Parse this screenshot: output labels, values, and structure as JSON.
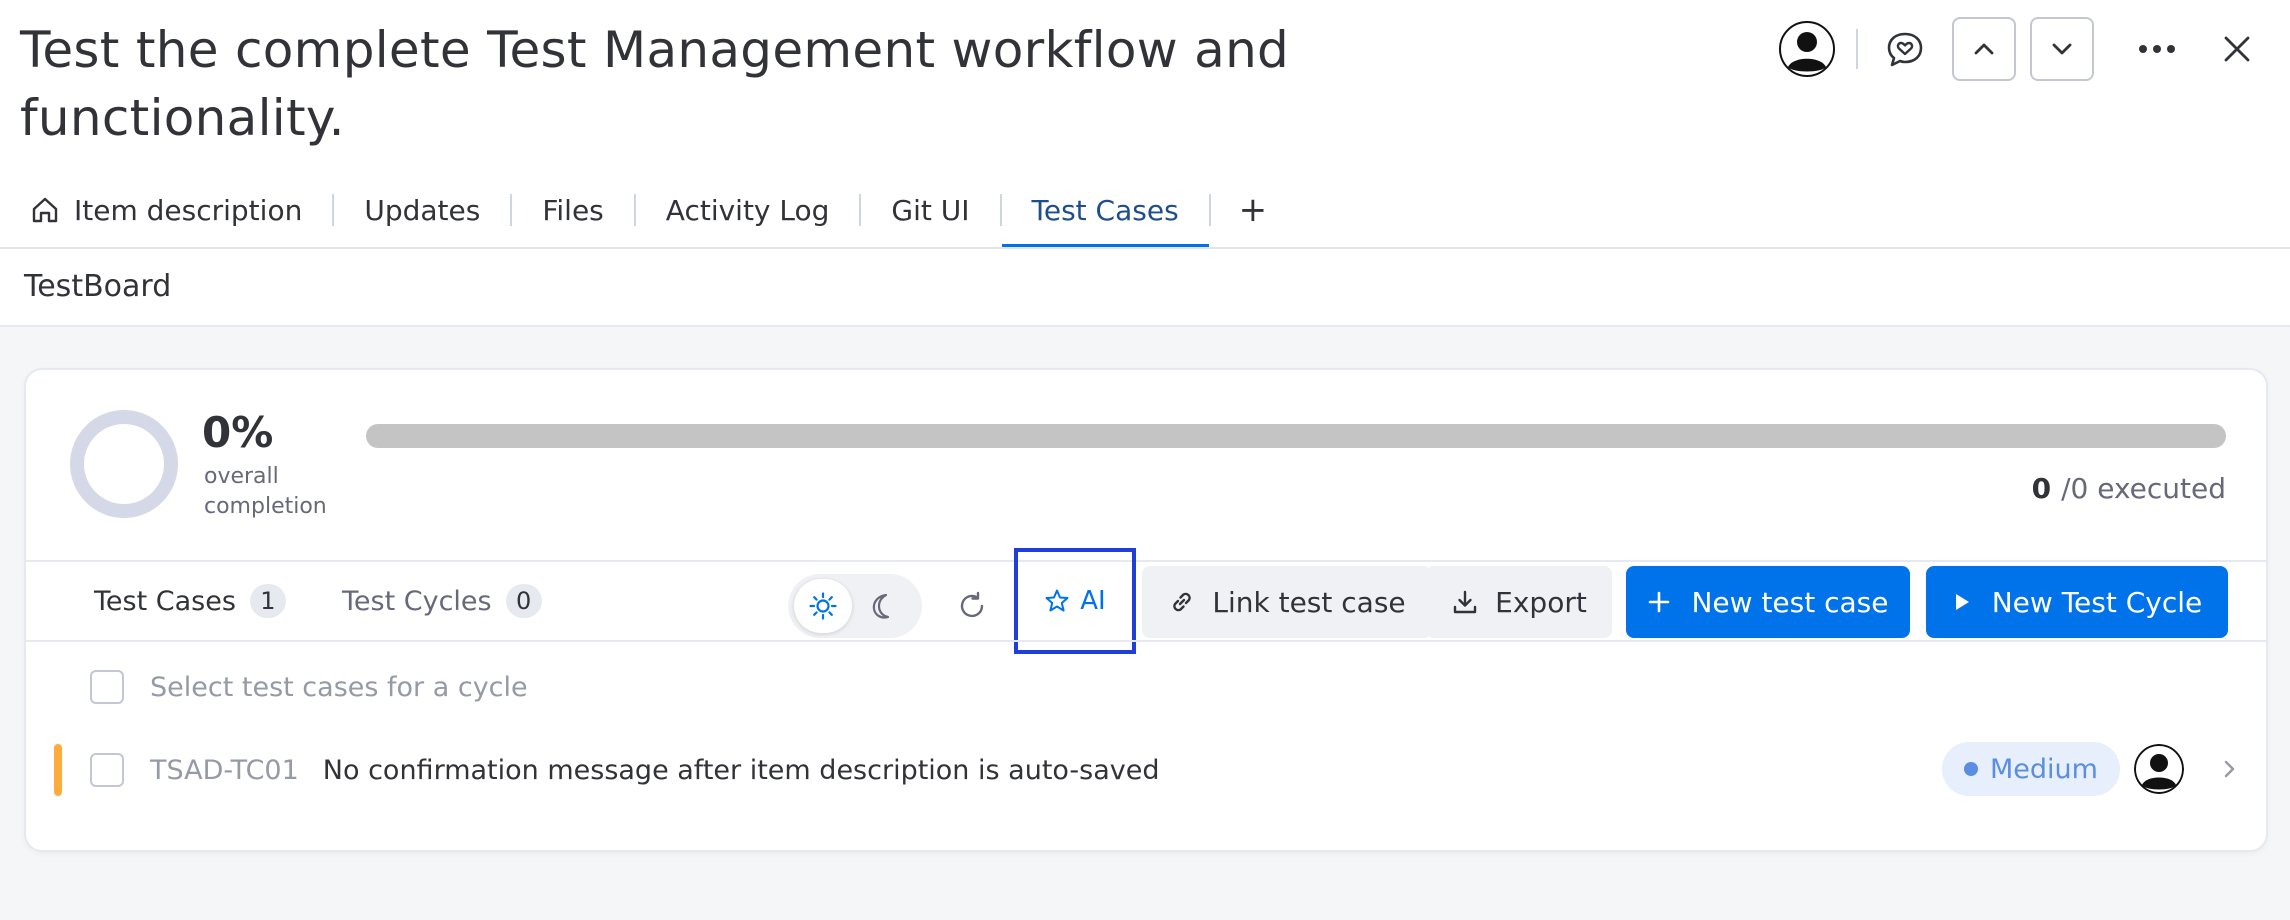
{
  "header": {
    "title": "Test the complete Test Management workflow and functionality."
  },
  "tabs": [
    {
      "label": "Item description",
      "icon": "home-icon",
      "active": false
    },
    {
      "label": "Updates",
      "active": false
    },
    {
      "label": "Files",
      "active": false
    },
    {
      "label": "Activity Log",
      "active": false
    },
    {
      "label": "Git UI",
      "active": false
    },
    {
      "label": "Test Cases",
      "active": true
    }
  ],
  "tab_add_label": "+",
  "board": {
    "name": "TestBoard"
  },
  "progress": {
    "percent_label": "0%",
    "percent_value": 0,
    "label": "overall completion",
    "executed_count": "0",
    "executed_total": "/0 executed"
  },
  "subtabs": [
    {
      "label": "Test Cases",
      "count": "1"
    },
    {
      "label": "Test Cycles",
      "count": "0"
    }
  ],
  "toolbar": {
    "ai_label": "AI",
    "link_label": "Link test case",
    "export_label": "Export",
    "new_case_label": "New test case",
    "new_cycle_label": "New Test Cycle"
  },
  "list": {
    "select_placeholder": "Select test cases for a cycle",
    "rows": [
      {
        "id": "TSAD-TC01",
        "title": "No confirmation message after item description is auto-saved",
        "priority": "Medium"
      }
    ]
  },
  "colors": {
    "accent": "#0073ea",
    "priority_medium_strip": "#fdab3d",
    "priority_badge_text": "#5b8de0",
    "highlight_box": "#1f3fd8"
  }
}
